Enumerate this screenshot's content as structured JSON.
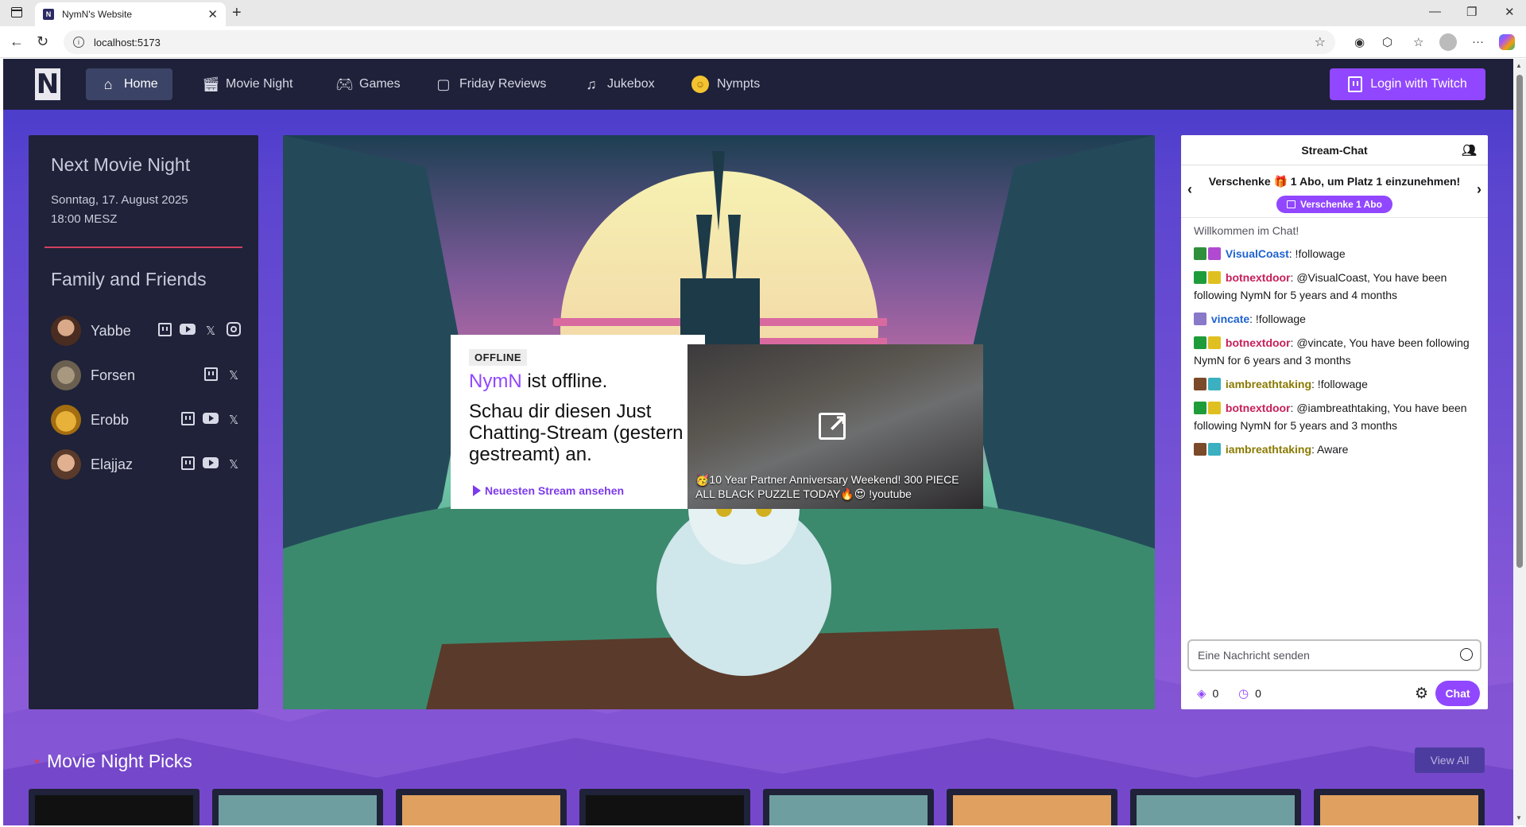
{
  "browser": {
    "tab_title": "NymN's Website",
    "favicon_text": "N",
    "url": "localhost:5173"
  },
  "nav": {
    "items": [
      {
        "label": "Home",
        "icon": "home-icon"
      },
      {
        "label": "Movie Night",
        "icon": "clapperboard-icon"
      },
      {
        "label": "Games",
        "icon": "gamepad-icon"
      },
      {
        "label": "Friday Reviews",
        "icon": "review-icon"
      },
      {
        "label": "Jukebox",
        "icon": "music-note-icon"
      },
      {
        "label": "Nympts",
        "icon": "coin-icon"
      }
    ],
    "login_label": "Login with Twitch",
    "accent": "#9147ff"
  },
  "sidebar": {
    "next_movie_heading": "Next Movie Night",
    "next_movie_date": "Sonntag, 17. August 2025",
    "next_movie_time": "18:00 MESZ",
    "friends_heading": "Family and Friends",
    "friends": [
      {
        "name": "Yabbe",
        "socials": [
          "twitch",
          "youtube",
          "x",
          "instagram"
        ]
      },
      {
        "name": "Forsen",
        "socials": [
          "twitch",
          "x"
        ]
      },
      {
        "name": "Erobb",
        "socials": [
          "twitch",
          "youtube",
          "x"
        ]
      },
      {
        "name": "Elajjaz",
        "socials": [
          "twitch",
          "youtube",
          "x"
        ]
      }
    ]
  },
  "hero": {
    "offline_badge": "OFFLINE",
    "streamer": "NymN",
    "offline_suffix": "ist offline.",
    "description": "Schau dir diesen Just Chatting-Stream (gestern gestreamt) an.",
    "watch_link": "Neuesten Stream ansehen",
    "video_title": "🥳10 Year Partner Anniversary Weekend! 300 PIECE ALL BLACK PUZZLE TODAY🔥😍 !youtube"
  },
  "chat": {
    "title": "Stream-Chat",
    "gift_text": "Verschenke 🎁 1 Abo, um Platz 1 einzunehmen!",
    "gift_button": "Verschenke 1 Abo",
    "welcome": "Willkommen im Chat!",
    "messages": [
      {
        "user": "VisualCoast",
        "color": "#1e62d0",
        "text": " !followage"
      },
      {
        "user": "botnextdoor",
        "color": "#c81e5a",
        "text": " @VisualCoast, You have been following NymN for 5 years and 4 months"
      },
      {
        "user": "vincate",
        "color": "#1e62d0",
        "text": " !followage"
      },
      {
        "user": "botnextdoor",
        "color": "#c81e5a",
        "text": " @vincate, You have been following NymN for 6 years and 3 months"
      },
      {
        "user": "iambreathtaking",
        "color": "#8a7a00",
        "text": " !followage"
      },
      {
        "user": "botnextdoor",
        "color": "#c81e5a",
        "text": " @iambreathtaking, You have been following NymN for 5 years and 3 months"
      },
      {
        "user": "iambreathtaking",
        "color": "#8a7a00",
        "text": " Aware"
      }
    ],
    "input_placeholder": "Eine Nachricht senden",
    "points_a": "0",
    "points_b": "0",
    "send_label": "Chat"
  },
  "picks": {
    "title": "Movie Night Picks",
    "view_all": "View All"
  }
}
